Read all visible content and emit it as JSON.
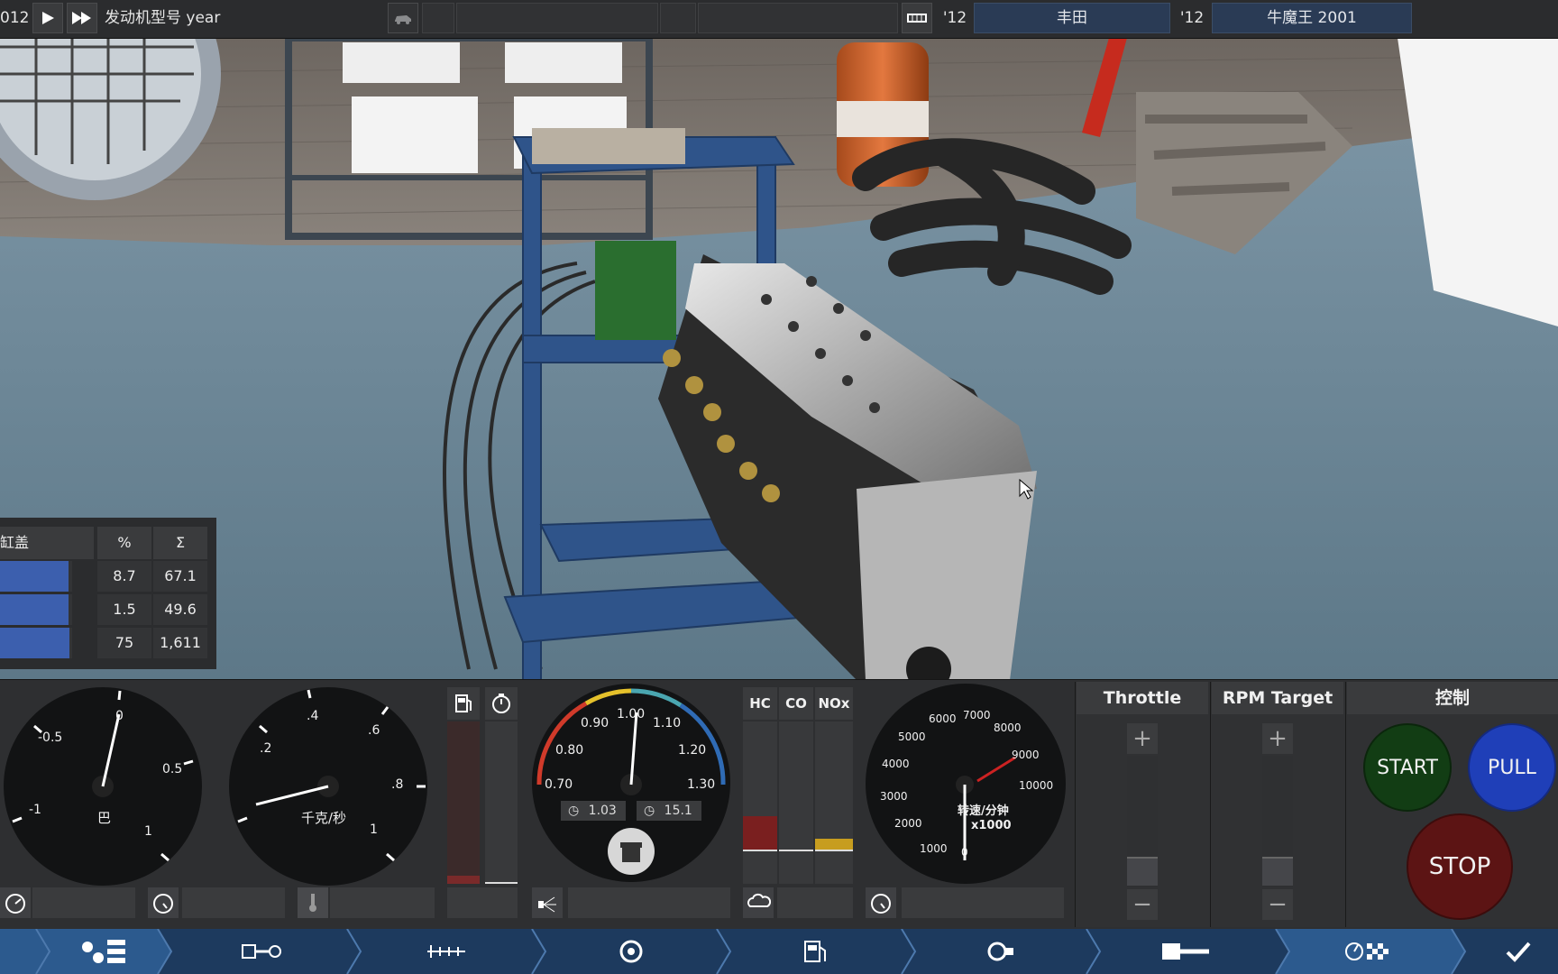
{
  "topbar": {
    "year_prefix": "012",
    "model_label": "发动机型号 year",
    "year_left": "'12",
    "make": "丰田",
    "year_right": "'12",
    "model": "牛魔王 2001"
  },
  "stats_table": {
    "headers": [
      "缸盖",
      "%",
      "Σ"
    ],
    "rows": [
      {
        "fill": 0.95,
        "pct": "8.7",
        "sum": "67.1"
      },
      {
        "fill": 0.95,
        "pct": "1.5",
        "sum": "49.6"
      },
      {
        "fill": 0.97,
        "pct": "75",
        "sum": "1,611"
      }
    ]
  },
  "gauges": {
    "pressure": {
      "ticks": [
        "-1",
        "-0.5",
        "0",
        "0.5",
        "1"
      ],
      "unit": "巴",
      "value": 0.1
    },
    "airflow": {
      "ticks": [
        ".2",
        ".4",
        ".6",
        ".8",
        "1"
      ],
      "unit": "千克/秒",
      "value": 0.05
    },
    "afr": {
      "ticks": [
        "0.70",
        "0.80",
        "0.90",
        "1.00",
        "1.10",
        "1.20",
        "1.30"
      ],
      "value": 1.01,
      "readout_left": "1.03",
      "readout_right": "15.1"
    },
    "rpm": {
      "ticks": [
        "0",
        "1000",
        "2000",
        "3000",
        "4000",
        "5000",
        "6000",
        "7000",
        "8000",
        "9000",
        "10000"
      ],
      "unit": "转速/分钟",
      "multiplier": "x1000",
      "redline": 9000,
      "value": 0
    }
  },
  "emissions": {
    "headers": [
      "HC",
      "CO",
      "NOx"
    ],
    "levels": [
      0.25,
      0.0,
      0.08
    ]
  },
  "fuel_bars": {
    "fuel": 0.05,
    "time": 0.0
  },
  "controls": {
    "throttle_label": "Throttle",
    "rpm_target_label": "RPM Target",
    "control_label": "控制",
    "plus": "+",
    "minus": "−",
    "start": "START",
    "pull": "PULL",
    "stop": "STOP",
    "throttle_value": 0.0,
    "rpm_target_value": 0.0
  },
  "colors": {
    "accent_blue": "#3c5fae",
    "start_green": "#123d14",
    "pull_blue": "#1f3fb8",
    "stop_red": "#5c1414",
    "nav_blue": "#1d3a5e"
  },
  "nav_icons": [
    "engine-family-icon",
    "bottom-end-icon",
    "top-end-icon",
    "turbo-icon",
    "fuel-icon",
    "ignition-icon",
    "exhaust-icon",
    "dyno-test-icon",
    "confirm-icon"
  ]
}
